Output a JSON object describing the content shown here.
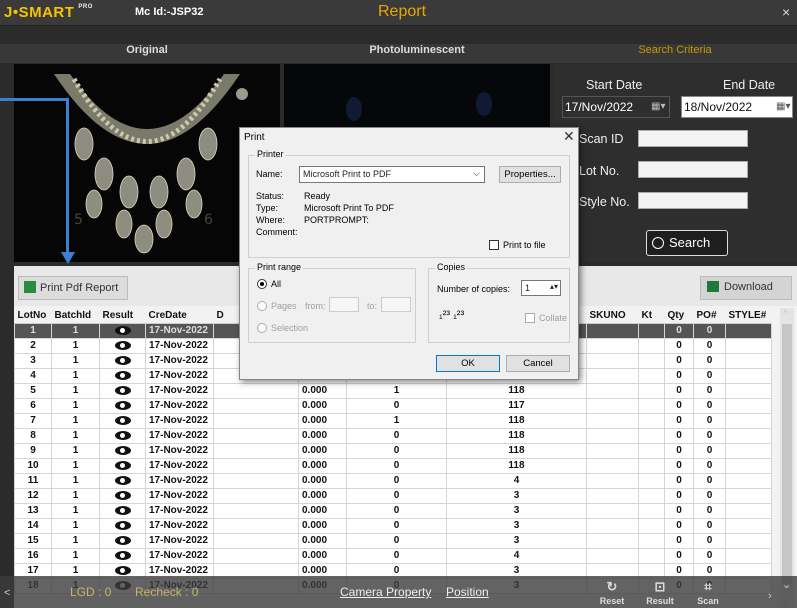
{
  "app": {
    "logo": "J•SMART",
    "logo_pro": "PRO",
    "machine_id": "Mc Id:-JSP32",
    "title": "Report",
    "close": "×"
  },
  "panels": {
    "original": "Original",
    "photoluminescent": "Photoluminescent",
    "search_criteria": "Search Criteria"
  },
  "search": {
    "start_date_label": "Start Date",
    "end_date_label": "End Date",
    "start_date": "17/Nov/2022",
    "end_date": "18/Nov/2022",
    "scan_id_label": "Scan ID",
    "lot_no_label": "Lot No.",
    "style_no_label": "Style No.",
    "search_button": "Search"
  },
  "toolbar": {
    "print_pdf": "Print Pdf Report",
    "download": "Download"
  },
  "table": {
    "columns": [
      "LotNo",
      "BatchId",
      "Result",
      "CreDate",
      "D",
      "",
      "",
      "",
      "SKUNO",
      "Kt",
      "Qty",
      "PO#",
      "STYLE#"
    ],
    "rows": [
      {
        "lot": "1",
        "batch": "1",
        "date": "17-Nov-2022",
        "c1": "",
        "c2": "",
        "c3": "",
        "qty": "0",
        "po": "0"
      },
      {
        "lot": "2",
        "batch": "1",
        "date": "17-Nov-2022",
        "c1": "",
        "c2": "",
        "c3": "",
        "qty": "0",
        "po": "0"
      },
      {
        "lot": "3",
        "batch": "1",
        "date": "17-Nov-2022",
        "c1": "",
        "c2": "",
        "c3": "",
        "qty": "0",
        "po": "0"
      },
      {
        "lot": "4",
        "batch": "1",
        "date": "17-Nov-2022",
        "c1": "",
        "c2": "",
        "c3": "",
        "qty": "0",
        "po": "0"
      },
      {
        "lot": "5",
        "batch": "1",
        "date": "17-Nov-2022",
        "c1": "0.000",
        "c2": "1",
        "c3": "118",
        "qty": "0",
        "po": "0"
      },
      {
        "lot": "6",
        "batch": "1",
        "date": "17-Nov-2022",
        "c1": "0.000",
        "c2": "0",
        "c3": "117",
        "qty": "0",
        "po": "0"
      },
      {
        "lot": "7",
        "batch": "1",
        "date": "17-Nov-2022",
        "c1": "0.000",
        "c2": "1",
        "c3": "118",
        "qty": "0",
        "po": "0"
      },
      {
        "lot": "8",
        "batch": "1",
        "date": "17-Nov-2022",
        "c1": "0.000",
        "c2": "0",
        "c3": "118",
        "qty": "0",
        "po": "0"
      },
      {
        "lot": "9",
        "batch": "1",
        "date": "17-Nov-2022",
        "c1": "0.000",
        "c2": "0",
        "c3": "118",
        "qty": "0",
        "po": "0"
      },
      {
        "lot": "10",
        "batch": "1",
        "date": "17-Nov-2022",
        "c1": "0.000",
        "c2": "0",
        "c3": "118",
        "qty": "0",
        "po": "0"
      },
      {
        "lot": "11",
        "batch": "1",
        "date": "17-Nov-2022",
        "c1": "0.000",
        "c2": "0",
        "c3": "4",
        "qty": "0",
        "po": "0"
      },
      {
        "lot": "12",
        "batch": "1",
        "date": "17-Nov-2022",
        "c1": "0.000",
        "c2": "0",
        "c3": "3",
        "qty": "0",
        "po": "0"
      },
      {
        "lot": "13",
        "batch": "1",
        "date": "17-Nov-2022",
        "c1": "0.000",
        "c2": "0",
        "c3": "3",
        "qty": "0",
        "po": "0"
      },
      {
        "lot": "14",
        "batch": "1",
        "date": "17-Nov-2022",
        "c1": "0.000",
        "c2": "0",
        "c3": "3",
        "qty": "0",
        "po": "0"
      },
      {
        "lot": "15",
        "batch": "1",
        "date": "17-Nov-2022",
        "c1": "0.000",
        "c2": "0",
        "c3": "3",
        "qty": "0",
        "po": "0"
      },
      {
        "lot": "16",
        "batch": "1",
        "date": "17-Nov-2022",
        "c1": "0.000",
        "c2": "0",
        "c3": "4",
        "qty": "0",
        "po": "0"
      },
      {
        "lot": "17",
        "batch": "1",
        "date": "17-Nov-2022",
        "c1": "0.000",
        "c2": "0",
        "c3": "3",
        "qty": "0",
        "po": "0"
      },
      {
        "lot": "18",
        "batch": "1",
        "date": "17-Nov-2022",
        "c1": "0.000",
        "c2": "0",
        "c3": "3",
        "qty": "0",
        "po": "0"
      }
    ]
  },
  "status": {
    "lgd": "LGD : 0",
    "recheck": "Recheck : 0",
    "camera_property": "Camera Property",
    "position": "Position",
    "reset": "Reset",
    "result": "Result",
    "scan": "Scan"
  },
  "print_dialog": {
    "title": "Print",
    "printer_group": "Printer",
    "name_label": "Name:",
    "name_value": "Microsoft Print to PDF",
    "properties": "Properties...",
    "status_label": "Status:",
    "status_value": "Ready",
    "type_label": "Type:",
    "type_value": "Microsoft Print To PDF",
    "where_label": "Where:",
    "where_value": "PORTPROMPT:",
    "comment_label": "Comment:",
    "print_to_file": "Print to file",
    "range_group": "Print range",
    "all": "All",
    "pages": "Pages",
    "from": "from:",
    "to": "to:",
    "selection": "Selection",
    "copies_group": "Copies",
    "num_copies_label": "Number of copies:",
    "num_copies": "1",
    "collate": "Collate",
    "ok": "OK",
    "cancel": "Cancel"
  }
}
